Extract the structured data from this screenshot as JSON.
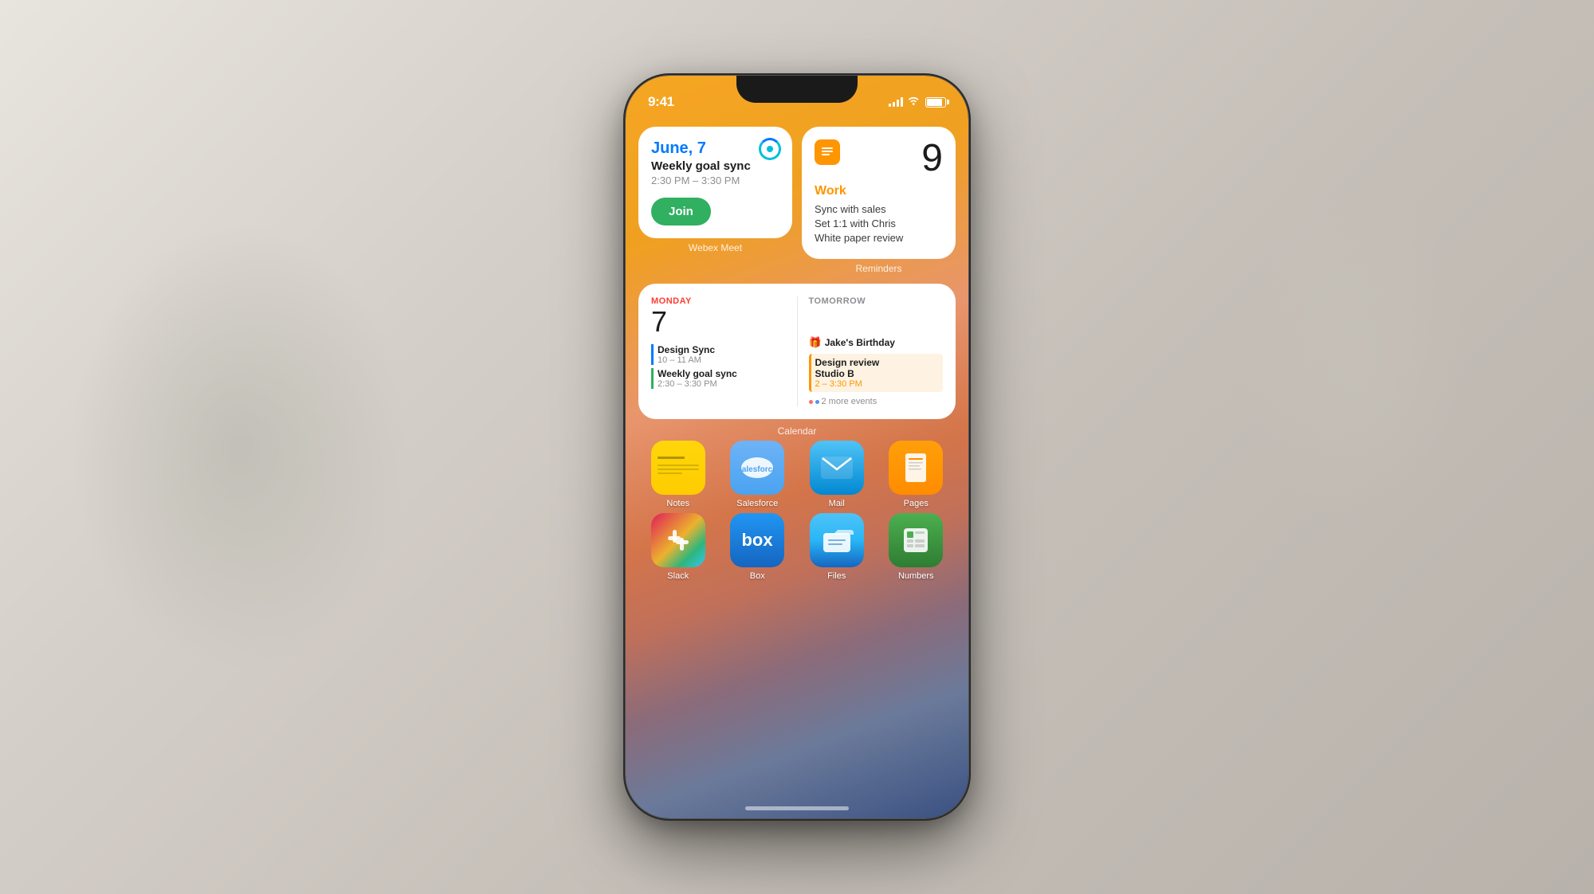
{
  "status_bar": {
    "time": "9:41",
    "battery_label": "battery"
  },
  "webex_widget": {
    "date": "June, 7",
    "event_title": "Weekly goal sync",
    "event_time": "2:30 PM – 3:30 PM",
    "join_button": "Join",
    "label": "Webex Meet"
  },
  "reminders_widget": {
    "count": "9",
    "category": "Work",
    "item1": "Sync with sales",
    "item2": "Set 1:1 with Chris",
    "item3": "White paper review",
    "label": "Reminders"
  },
  "calendar_widget": {
    "today_label": "MONDAY",
    "today_date": "7",
    "event1_title": "Design Sync",
    "event1_time": "10 – 11 AM",
    "event2_title": "Weekly goal sync",
    "event2_time": "2:30 – 3:30 PM",
    "tomorrow_label": "TOMORROW",
    "birthday_icon": "🎁",
    "birthday_text": "Jake's Birthday",
    "event3_title": "Design review",
    "event3_subtitle": "Studio B",
    "event3_time": "2 – 3:30 PM",
    "more_events": "2 more events",
    "label": "Calendar"
  },
  "apps_row1": [
    {
      "name": "Notes",
      "icon_type": "notes"
    },
    {
      "name": "Salesforce",
      "icon_type": "salesforce"
    },
    {
      "name": "Mail",
      "icon_type": "mail"
    },
    {
      "name": "Pages",
      "icon_type": "pages"
    }
  ],
  "apps_row2": [
    {
      "name": "Slack",
      "icon_type": "slack"
    },
    {
      "name": "Box",
      "icon_type": "box"
    },
    {
      "name": "Files",
      "icon_type": "files"
    },
    {
      "name": "Numbers",
      "icon_type": "numbers"
    }
  ]
}
